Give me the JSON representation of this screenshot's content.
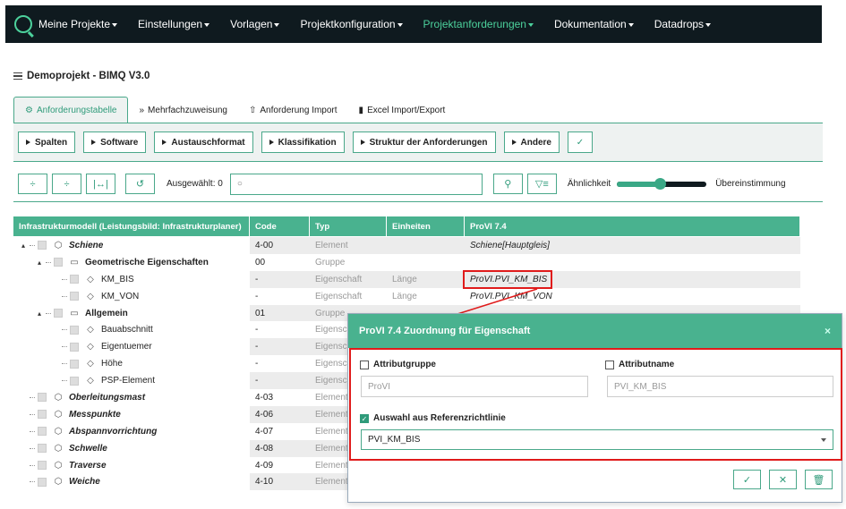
{
  "nav": {
    "items": [
      {
        "label": "Meine Projekte",
        "active": false
      },
      {
        "label": "Einstellungen",
        "active": false
      },
      {
        "label": "Vorlagen",
        "active": false
      },
      {
        "label": "Projektkonfiguration",
        "active": false
      },
      {
        "label": "Projektanforderungen",
        "active": true
      },
      {
        "label": "Dokumentation",
        "active": false
      },
      {
        "label": "Datadrops",
        "active": false
      }
    ]
  },
  "project": {
    "title": "Demoprojekt - BIMQ V3.0"
  },
  "tabs": [
    {
      "label": "Anforderungstabelle",
      "icon": "sliders-icon",
      "active": true
    },
    {
      "label": "Mehrfachzuweisung",
      "icon": "double-chevron-icon",
      "active": false
    },
    {
      "label": "Anforderung Import",
      "icon": "upload-icon",
      "active": false
    },
    {
      "label": "Excel Import/Export",
      "icon": "file-icon",
      "active": false
    }
  ],
  "toolbar": {
    "buttons": [
      "Spalten",
      "Software",
      "Austauschformat",
      "Klassifikation",
      "Struktur der Anforderungen",
      "Andere"
    ],
    "selected_label": "Ausgewählt: 0",
    "search_placeholder": "",
    "slider_left": "Ähnlichkeit",
    "slider_right": "Übereinstimmung",
    "slider_value": 0.48
  },
  "table": {
    "headers": [
      "Infrastrukturmodell (Leistungsbild: Infrastrukturplaner)",
      "Code",
      "Typ",
      "Einheiten",
      "ProVI 7.4"
    ],
    "rows": [
      {
        "name": "Schiene",
        "code": "4-00",
        "typ": "Element",
        "einheit": "",
        "provi": "Schiene[Hauptgleis]"
      },
      {
        "name": "Geometrische Eigenschaften",
        "code": "00",
        "typ": "Gruppe",
        "einheit": "",
        "provi": ""
      },
      {
        "name": "KM_BIS",
        "code": "-",
        "typ": "Eigenschaft",
        "einheit": "Länge",
        "provi": "ProVI.PVI_KM_BIS"
      },
      {
        "name": "KM_VON",
        "code": "-",
        "typ": "Eigenschaft",
        "einheit": "Länge",
        "provi": "ProVI.PVI_KM_VON"
      },
      {
        "name": "Allgemein",
        "code": "01",
        "typ": "Gruppe",
        "einheit": "",
        "provi": ""
      },
      {
        "name": "Bauabschnitt",
        "code": "-",
        "typ": "Eigenschaft",
        "einheit": "",
        "provi": ""
      },
      {
        "name": "Eigentuemer",
        "code": "-",
        "typ": "Eigenschaft",
        "einheit": "",
        "provi": ""
      },
      {
        "name": "Höhe",
        "code": "-",
        "typ": "Eigenschaft",
        "einheit": "",
        "provi": ""
      },
      {
        "name": "PSP-Element",
        "code": "-",
        "typ": "Eigenschaft",
        "einheit": "",
        "provi": ""
      },
      {
        "name": "Oberleitungsmast",
        "code": "4-03",
        "typ": "Element",
        "einheit": "",
        "provi": ""
      },
      {
        "name": "Messpunkte",
        "code": "4-06",
        "typ": "Element",
        "einheit": "",
        "provi": ""
      },
      {
        "name": "Abspannvorrichtung",
        "code": "4-07",
        "typ": "Element",
        "einheit": "",
        "provi": ""
      },
      {
        "name": "Schwelle",
        "code": "4-08",
        "typ": "Element",
        "einheit": "",
        "provi": ""
      },
      {
        "name": "Traverse",
        "code": "4-09",
        "typ": "Element",
        "einheit": "",
        "provi": ""
      },
      {
        "name": "Weiche",
        "code": "4-10",
        "typ": "Element",
        "einheit": "",
        "provi": ""
      }
    ]
  },
  "modal": {
    "title": "ProVI 7.4 Zuordnung für Eigenschaft",
    "attributgruppe_label": "Attributgruppe",
    "attributgruppe_value": "ProVI",
    "attributname_label": "Attributname",
    "attributname_value": "PVI_KM_BIS",
    "referenz_label": "Auswahl aus Referenzrichtlinie",
    "referenz_value": "PVI_KM_BIS"
  },
  "colors": {
    "accent": "#49b28f",
    "nav_bg": "#0f1a1f",
    "active_nav": "#4cd19c",
    "highlight": "#e01b1b"
  }
}
